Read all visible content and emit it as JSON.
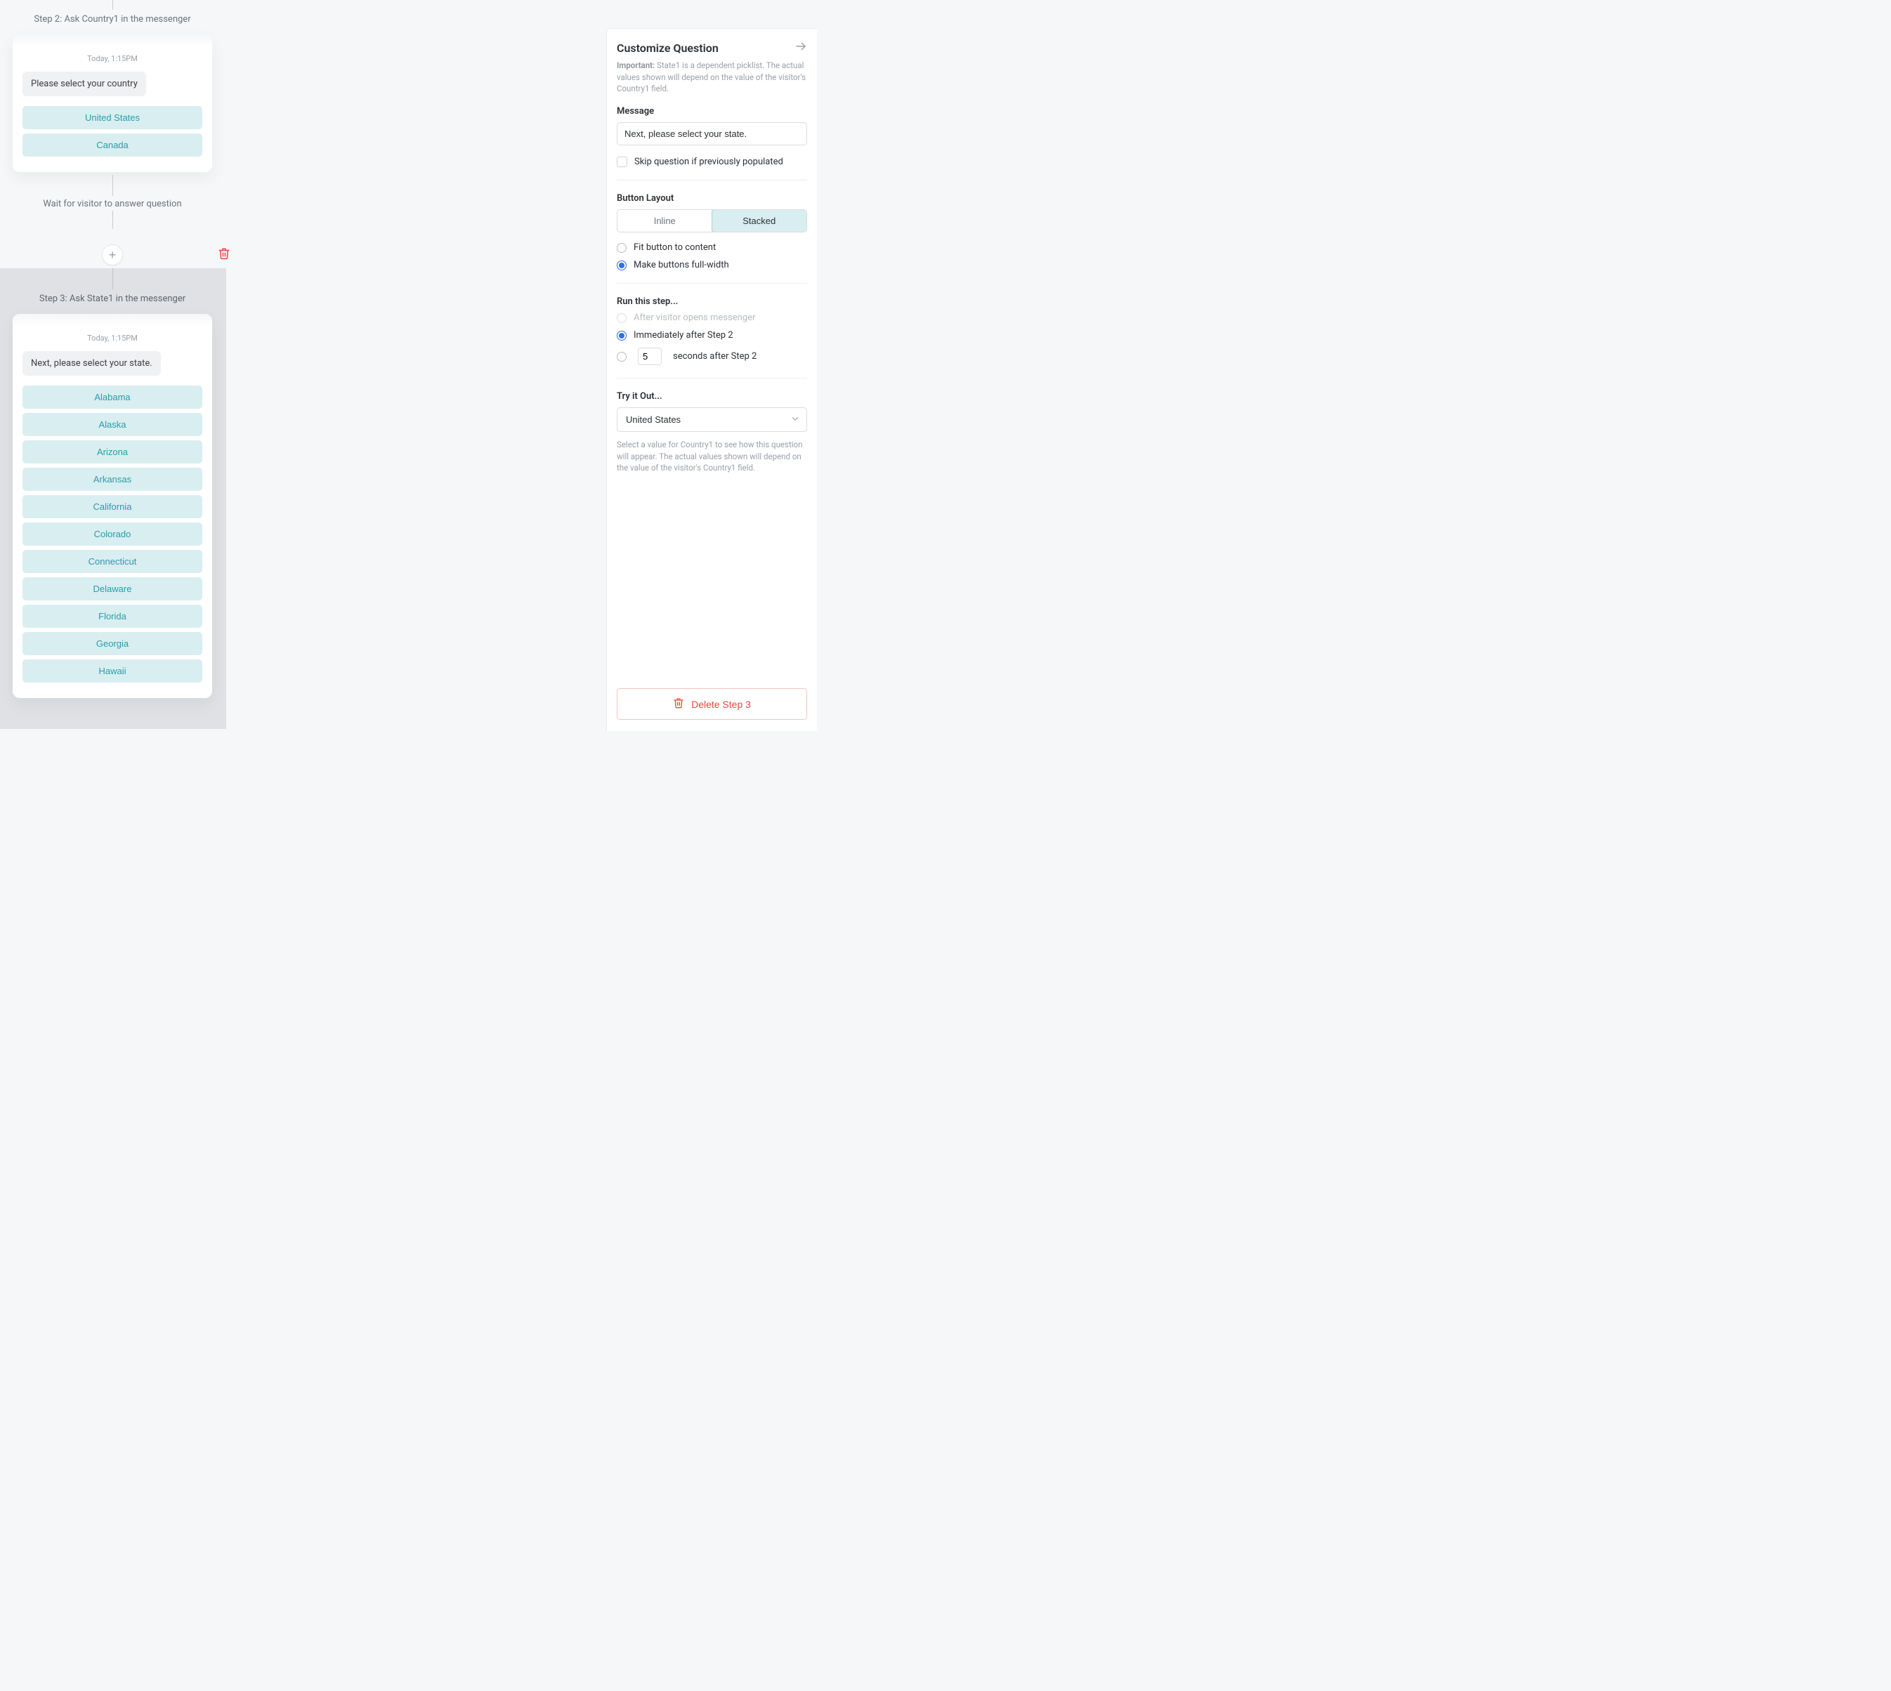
{
  "flow": {
    "step2": {
      "label": "Step 2: Ask Country1 in the messenger",
      "timestamp": "Today, 1:15PM",
      "prompt": "Please select your country",
      "options": [
        "United States",
        "Canada"
      ]
    },
    "wait_label": "Wait for visitor to answer question",
    "step3": {
      "label": "Step 3: Ask State1 in the messenger",
      "timestamp": "Today, 1:15PM",
      "prompt": "Next, please select your state.",
      "options": [
        "Alabama",
        "Alaska",
        "Arizona",
        "Arkansas",
        "California",
        "Colorado",
        "Connecticut",
        "Delaware",
        "Florida",
        "Georgia",
        "Hawaii"
      ]
    }
  },
  "panel": {
    "title": "Customize Question",
    "important_label": "Important:",
    "important_text": "State1 is a dependent picklist. The actual values shown will depend on the value of the visitor's Country1 field.",
    "message_label": "Message",
    "message_value": "Next, please select your state.",
    "skip_label": "Skip question if previously populated",
    "layout_label": "Button Layout",
    "layout_inline": "Inline",
    "layout_stacked": "Stacked",
    "fit_label": "Fit button to content",
    "full_label": "Make buttons full-width",
    "run_label": "Run this step...",
    "run_after_open": "After visitor opens messenger",
    "run_after_step": "Immediately after Step 2",
    "run_seconds_value": "5",
    "run_seconds_suffix": "seconds after Step 2",
    "tryout_label": "Try it Out...",
    "tryout_selected": "United States",
    "tryout_helper": "Select a value for Country1 to see how this question will appear. The actual values shown will depend on the value of the visitor's Country1 field.",
    "delete_label": "Delete Step 3"
  }
}
